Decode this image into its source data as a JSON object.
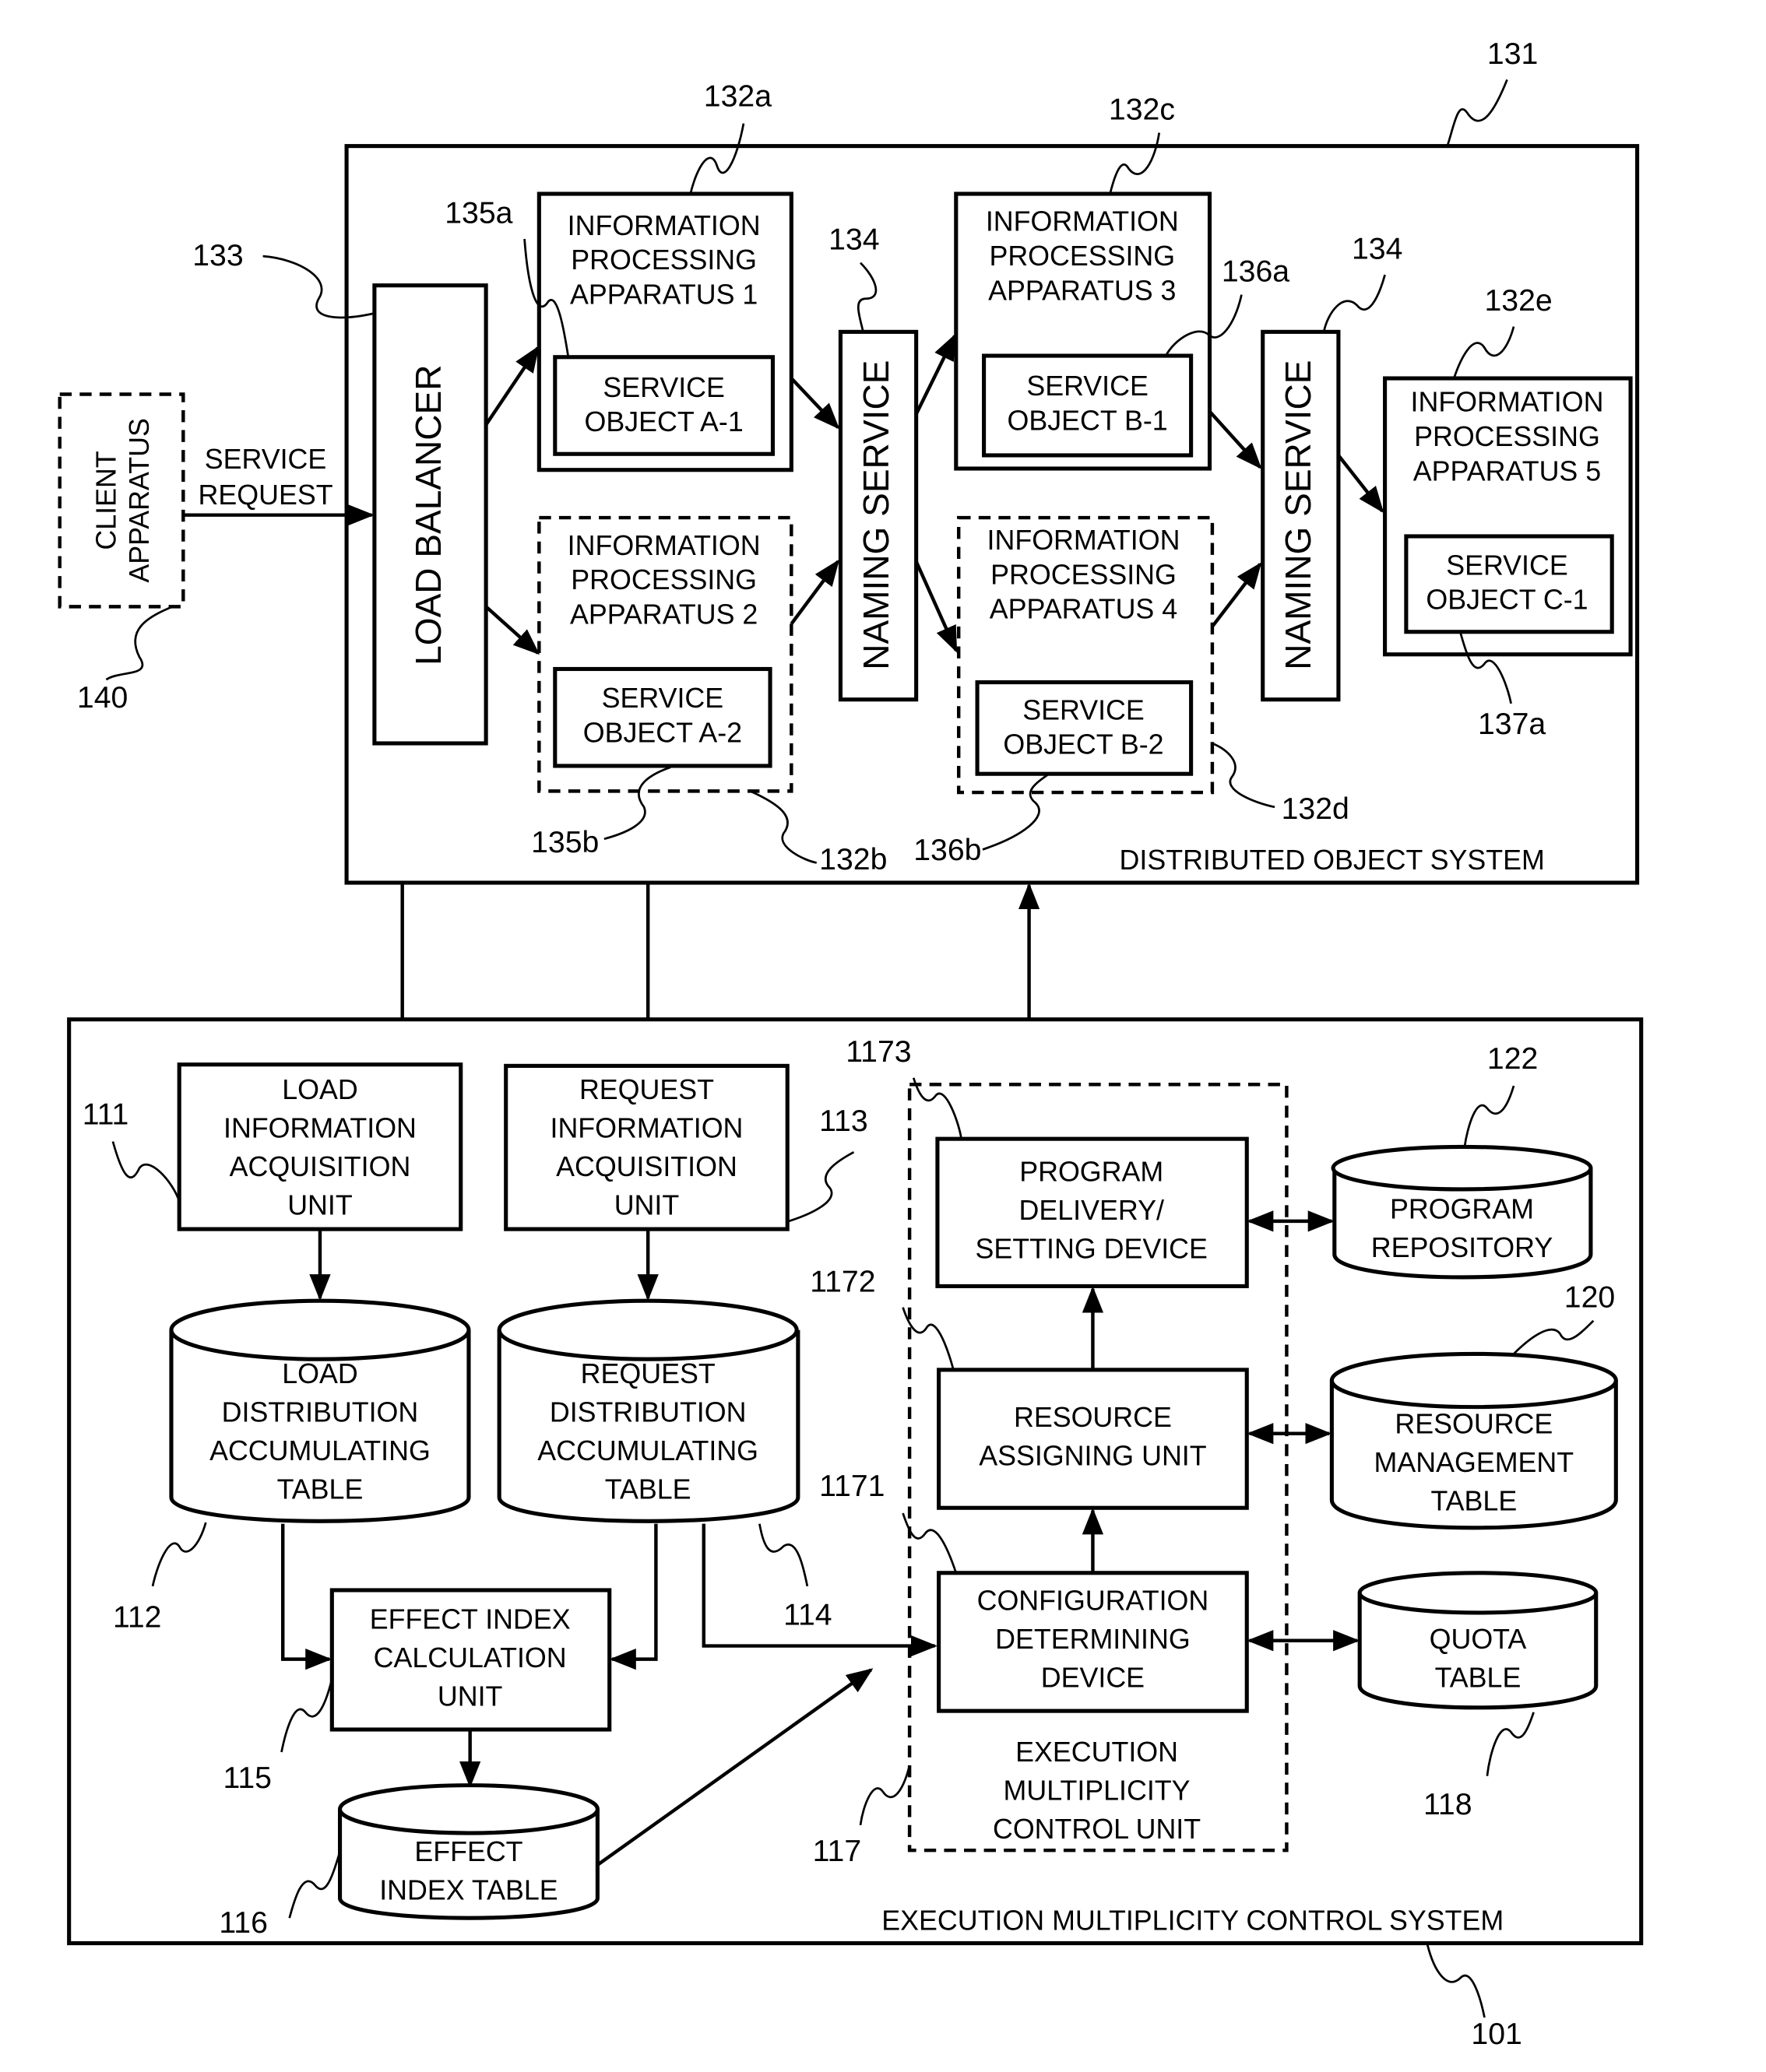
{
  "figure": {
    "distributed_system": {
      "ref": "131",
      "label": "DISTRIBUTED OBJECT SYSTEM",
      "client": {
        "ref": "140",
        "lines": [
          "CLIENT",
          "APPARATUS"
        ]
      },
      "service_request": [
        "SERVICE",
        "REQUEST"
      ],
      "load_balancer": {
        "ref": "133",
        "label": "LOAD BALANCER"
      },
      "naming_service_1": {
        "ref": "134",
        "label": "NAMING SERVICE"
      },
      "naming_service_2": {
        "ref": "134",
        "label": "NAMING SERVICE"
      },
      "apparatus": [
        {
          "ref": "132a",
          "lines": [
            "INFORMATION",
            "PROCESSING",
            "APPARATUS 1"
          ],
          "object_ref": "135a",
          "object": [
            "SERVICE",
            "OBJECT A-1"
          ],
          "dashed": false
        },
        {
          "ref": "132b",
          "lines": [
            "INFORMATION",
            "PROCESSING",
            "APPARATUS 2"
          ],
          "object_ref": "135b",
          "object": [
            "SERVICE",
            "OBJECT A-2"
          ],
          "dashed": true
        },
        {
          "ref": "132c",
          "lines": [
            "INFORMATION",
            "PROCESSING",
            "APPARATUS 3"
          ],
          "object_ref": "136a",
          "object": [
            "SERVICE",
            "OBJECT B-1"
          ],
          "dashed": false
        },
        {
          "ref": "132d",
          "lines": [
            "INFORMATION",
            "PROCESSING",
            "APPARATUS 4"
          ],
          "object_ref": "136b",
          "object": [
            "SERVICE",
            "OBJECT B-2"
          ],
          "dashed": true
        },
        {
          "ref": "132e",
          "lines": [
            "INFORMATION",
            "PROCESSING",
            "APPARATUS 5"
          ],
          "object_ref": "137a",
          "object": [
            "SERVICE",
            "OBJECT C-1"
          ],
          "dashed": false
        }
      ]
    },
    "control_system": {
      "ref": "101",
      "label": "EXECUTION MULTIPLICITY CONTROL SYSTEM",
      "load_info_unit": {
        "ref": "111",
        "lines": [
          "LOAD",
          "INFORMATION",
          "ACQUISITION",
          "UNIT"
        ]
      },
      "request_info_unit": {
        "ref": "113",
        "lines": [
          "REQUEST",
          "INFORMATION",
          "ACQUISITION",
          "UNIT"
        ]
      },
      "load_table": {
        "ref": "112",
        "lines": [
          "LOAD",
          "DISTRIBUTION",
          "ACCUMULATING",
          "TABLE"
        ]
      },
      "request_table": {
        "ref": "114",
        "lines": [
          "REQUEST",
          "DISTRIBUTION",
          "ACCUMULATING",
          "TABLE"
        ]
      },
      "effect_calc_unit": {
        "ref": "115",
        "lines": [
          "EFFECT INDEX",
          "CALCULATION",
          "UNIT"
        ]
      },
      "effect_table": {
        "ref": "116",
        "lines": [
          "EFFECT",
          "INDEX TABLE"
        ]
      },
      "control_unit": {
        "ref": "117",
        "lines": [
          "EXECUTION",
          "MULTIPLICITY",
          "CONTROL UNIT"
        ]
      },
      "program_delivery": {
        "ref": "1173",
        "lines": [
          "PROGRAM",
          "DELIVERY/",
          "SETTING DEVICE"
        ]
      },
      "resource_assigning": {
        "ref": "1172",
        "lines": [
          "RESOURCE",
          "ASSIGNING UNIT"
        ]
      },
      "config_determining": {
        "ref": "1171",
        "lines": [
          "CONFIGURATION",
          "DETERMINING",
          "DEVICE"
        ]
      },
      "program_repository": {
        "ref": "122",
        "lines": [
          "PROGRAM",
          "REPOSITORY"
        ]
      },
      "resource_table": {
        "ref": "120",
        "lines": [
          "RESOURCE",
          "MANAGEMENT",
          "TABLE"
        ]
      },
      "quota_table": {
        "ref": "118",
        "lines": [
          "QUOTA",
          "TABLE"
        ]
      }
    }
  }
}
